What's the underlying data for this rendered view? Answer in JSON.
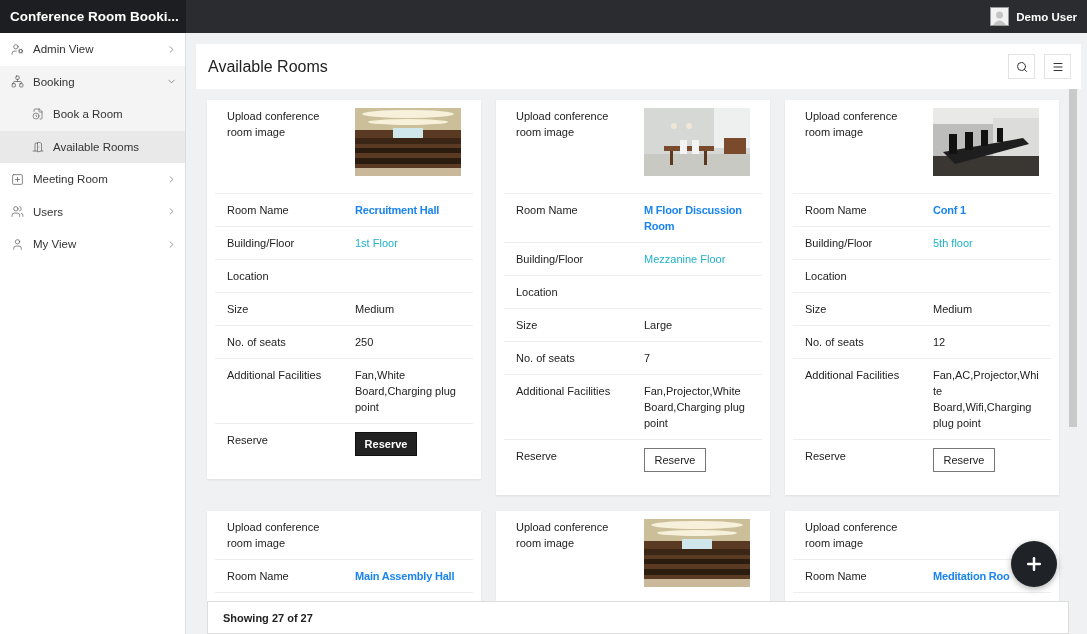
{
  "app": {
    "title": "Conference Room Booki...",
    "user": "Demo User"
  },
  "sidebar": {
    "items": [
      {
        "label": "Admin View",
        "expanded": false
      },
      {
        "label": "Booking",
        "expanded": true,
        "children": [
          {
            "label": "Book a Room",
            "selected": false
          },
          {
            "label": "Available Rooms",
            "selected": true
          }
        ]
      },
      {
        "label": "Meeting Room",
        "expanded": false
      },
      {
        "label": "Users",
        "expanded": false
      },
      {
        "label": "My View",
        "expanded": false
      }
    ]
  },
  "panel": {
    "title": "Available Rooms",
    "footer": "Showing 27 of 27"
  },
  "rooms": [
    {
      "rows": [
        {
          "label": "Upload conference room image",
          "has_image": true
        },
        {
          "kind": "name",
          "label": "Room Name",
          "value": "Recruitment Hall"
        },
        {
          "kind": "floor",
          "label": "Building/Floor",
          "value": "1st Floor"
        },
        {
          "kind": "text",
          "label": "Location",
          "value": ""
        },
        {
          "kind": "text",
          "label": "Size",
          "value": "Medium"
        },
        {
          "kind": "text",
          "label": "No. of seats",
          "value": "250"
        },
        {
          "kind": "text",
          "label": "Additional Facilities",
          "value": "Fan,White Board,Charging plug point"
        },
        {
          "kind": "reserve",
          "label": "Reserve",
          "value": "Reserve",
          "selected": true
        }
      ]
    },
    {
      "rows": [
        {
          "label": "Upload conference room image",
          "has_image": true
        },
        {
          "kind": "name",
          "label": "Room Name",
          "value": "M Floor Discussion Room"
        },
        {
          "kind": "floor",
          "label": "Building/Floor",
          "value": "Mezzanine Floor"
        },
        {
          "kind": "text",
          "label": "Location",
          "value": ""
        },
        {
          "kind": "text",
          "label": "Size",
          "value": "Large"
        },
        {
          "kind": "text",
          "label": "No. of seats",
          "value": "7"
        },
        {
          "kind": "text",
          "label": "Additional Facilities",
          "value": "Fan,Projector,White Board,Charging plug point"
        },
        {
          "kind": "reserve",
          "label": "Reserve",
          "value": "Reserve",
          "selected": false
        }
      ]
    },
    {
      "rows": [
        {
          "label": "Upload conference room image",
          "has_image": true
        },
        {
          "kind": "name",
          "label": "Room Name",
          "value": "Conf 1"
        },
        {
          "kind": "floor",
          "label": "Building/Floor",
          "value": "5th floor"
        },
        {
          "kind": "text",
          "label": "Location",
          "value": ""
        },
        {
          "kind": "text",
          "label": "Size",
          "value": "Medium"
        },
        {
          "kind": "text",
          "label": "No. of seats",
          "value": "12"
        },
        {
          "kind": "text",
          "label": "Additional Facilities",
          "value": "Fan,AC,Projector,White Board,Wifi,Charging plug point"
        },
        {
          "kind": "reserve",
          "label": "Reserve",
          "value": "Reserve",
          "selected": false
        }
      ]
    },
    {
      "rows": [
        {
          "label": "Upload conference room image",
          "has_image": false
        },
        {
          "kind": "name",
          "label": "Room Name",
          "value": "Main Assembly Hall"
        }
      ]
    },
    {
      "rows": [
        {
          "label": "Upload conference room image",
          "has_image": true
        }
      ]
    },
    {
      "rows": [
        {
          "label": "Upload conference room image",
          "has_image": false
        },
        {
          "kind": "name",
          "label": "Room Name",
          "value": "Meditation Roo"
        }
      ]
    }
  ]
}
